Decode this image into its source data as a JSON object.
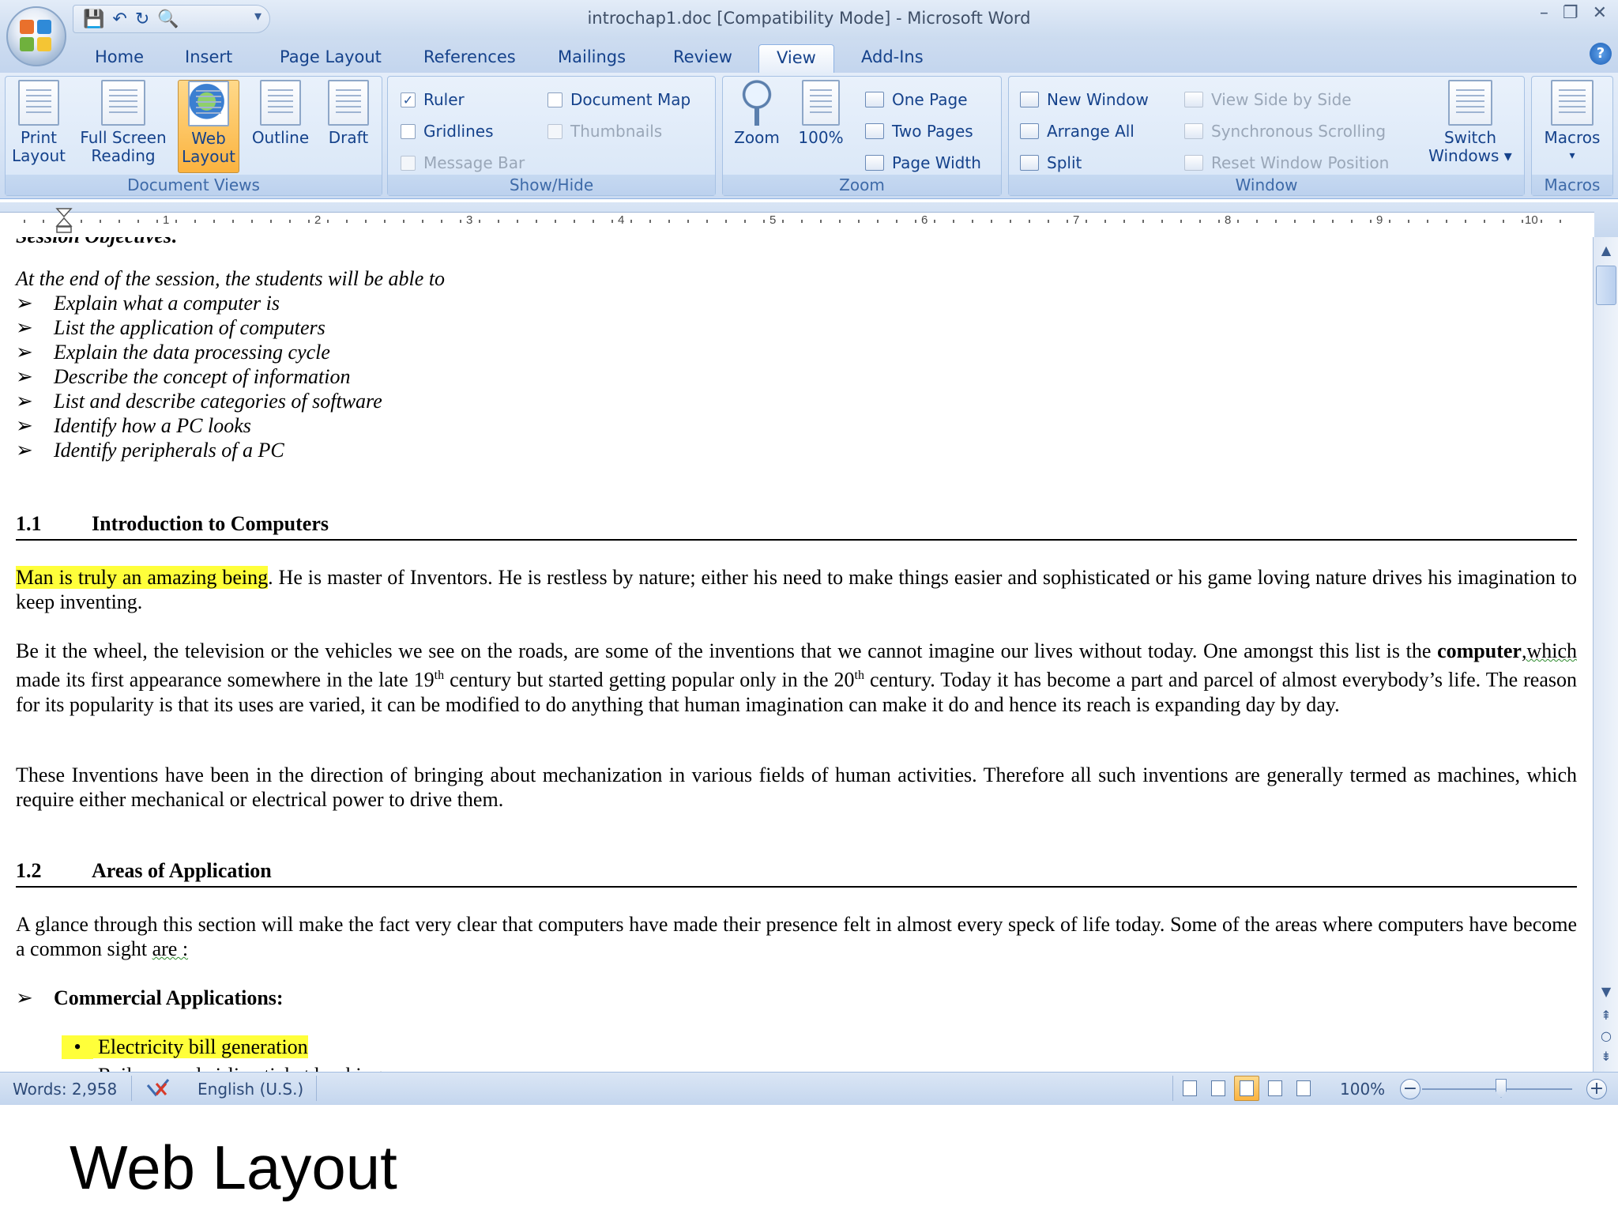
{
  "window": {
    "title": "introchap1.doc [Compatibility Mode] - Microsoft Word",
    "minimize": "–",
    "restore": "❐",
    "close": "✕"
  },
  "qat": {
    "save_icon": "💾",
    "undo_icon": "↶",
    "redo_icon": "↻",
    "preview_icon": "🔍",
    "more": "▾"
  },
  "tabs": [
    {
      "label": "Home"
    },
    {
      "label": "Insert"
    },
    {
      "label": "Page Layout"
    },
    {
      "label": "References"
    },
    {
      "label": "Mailings"
    },
    {
      "label": "Review"
    },
    {
      "label": "View"
    },
    {
      "label": "Add-Ins"
    }
  ],
  "active_tab": "View",
  "help": "?",
  "ribbon": {
    "document_views": {
      "label": "Document Views",
      "print_layout": [
        "Print",
        "Layout"
      ],
      "full_screen_reading": [
        "Full Screen",
        "Reading"
      ],
      "web_layout": [
        "Web",
        "Layout"
      ],
      "outline": "Outline",
      "draft": "Draft"
    },
    "show_hide": {
      "label": "Show/Hide",
      "ruler": "Ruler",
      "ruler_checked": "✓",
      "gridlines": "Gridlines",
      "message_bar": "Message Bar",
      "document_map": "Document Map",
      "thumbnails": "Thumbnails"
    },
    "zoom": {
      "label": "Zoom",
      "zoom": "Zoom",
      "percent": "100%",
      "one_page": "One Page",
      "two_pages": "Two Pages",
      "page_width": "Page Width"
    },
    "window": {
      "label": "Window",
      "new_window": "New Window",
      "arrange_all": "Arrange All",
      "split": "Split",
      "view_side_by_side": "View Side by Side",
      "synchronous_scrolling": "Synchronous Scrolling",
      "reset_window_position": "Reset Window Position",
      "switch_windows": [
        "Switch",
        "Windows ▾"
      ]
    },
    "macros": {
      "label": "Macros",
      "macros": "Macros",
      "arrow": "▾"
    }
  },
  "ruler": {
    "numbers": [
      "1",
      "2",
      "3",
      "4",
      "5",
      "6",
      "7",
      "8",
      "9",
      "10"
    ]
  },
  "document": {
    "cut_heading": "Session Objectives:",
    "intro": "At the end of the session, the students will be able to",
    "objectives": [
      "Explain what a computer is",
      "List the application of computers",
      "Explain the data processing cycle",
      "Describe the concept of information",
      "List and describe categories of software",
      "Identify how a PC looks",
      "Identify peripherals of a PC"
    ],
    "bullet_arrow": "➢",
    "section1": {
      "num": "1.1",
      "title": "Introduction to Computers"
    },
    "p1_highlight": "Man is truly an amazing being",
    "p1_rest": ". He is master of Inventors. He is restless by nature; either his need to make things easier and sophisticated or his game loving nature drives his imagination to keep inventing.",
    "p2_a": "Be it the wheel, the television or the vehicles we see on the roads, are some of the inventions that we cannot imagine our lives without today. One amongst this list is the ",
    "p2_bold": "computer",
    "p2_squig": ",which",
    "p2_b": " made its first appearance somewhere in the late 19",
    "p2_sup1": "th",
    "p2_c": " century but started getting popular only in the 20",
    "p2_sup2": "th",
    "p2_d": " century.  Today it has become a part and parcel of almost everybody’s life. The reason for its popularity is that its uses are varied, it can be modified to do anything that human imagination can make it do and hence its reach is expanding day by day.",
    "p3": "These Inventions have been in the direction of bringing about mechanization   in various fields of human activities. Therefore all such inventions are generally termed as machines, which require either mechanical or electrical power to drive them.",
    "section2": {
      "num": "1.2",
      "title": "Areas of Application"
    },
    "p4_a": "A glance through this section will make the fact very clear that computers have made their presence felt in almost every speck of life today. Some of the areas where computers have become a common sight ",
    "p4_squig": "are :",
    "sub_heading": "Commercial Applications:",
    "bullet_dot": "•",
    "bullet1": "Electricity bill generation",
    "cut_bullet": "Railway and airline ticket booking"
  },
  "status": {
    "words": "Words: 2,958",
    "language": "English (U.S.)",
    "zoom": "100%",
    "zoom_out": "−",
    "zoom_in": "+"
  },
  "scroll": {
    "up": "▲",
    "down": "▼",
    "prev": "⇞",
    "select": "○",
    "next": "⇟"
  },
  "caption": "Web Layout"
}
